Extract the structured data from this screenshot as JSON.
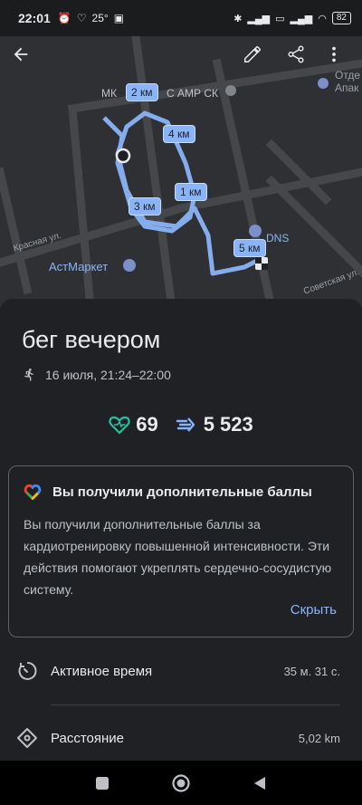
{
  "status_bar": {
    "time": "22:01",
    "temperature": "25°",
    "battery": "82"
  },
  "map": {
    "km_markers": [
      "2 км",
      "4 км",
      "1 км",
      "3 км",
      "5 км"
    ],
    "places": {
      "mk": "МК",
      "amp": "С АМР СК",
      "otd": "Отде",
      "apak": "Апак",
      "dns": "DNS",
      "astmarket": "АстМаркет",
      "krasnaya": "Красная ул.",
      "sovetskaya": "Советская ул."
    },
    "route_color": "#8ab4f8"
  },
  "workout": {
    "title": "бег вечером",
    "datetime": "16 июля, 21:24–22:00",
    "heart_points": "69",
    "steps": "5 523"
  },
  "bonus_card": {
    "title": "Вы получили дополнительные баллы",
    "body": "Вы получили дополнительные баллы за кардиотренировку повышенной интенсивности. Эти действия помогают укреплять сердечно-сосудистую систему.",
    "action": "Скрыть"
  },
  "metrics": [
    {
      "label": "Активное время",
      "value": "35 м. 31 с."
    },
    {
      "label": "Расстояние",
      "value": "5,02 km"
    }
  ],
  "colors": {
    "accent": "#8ab4f8",
    "heart": "#24c1a0",
    "background": "#202124"
  }
}
